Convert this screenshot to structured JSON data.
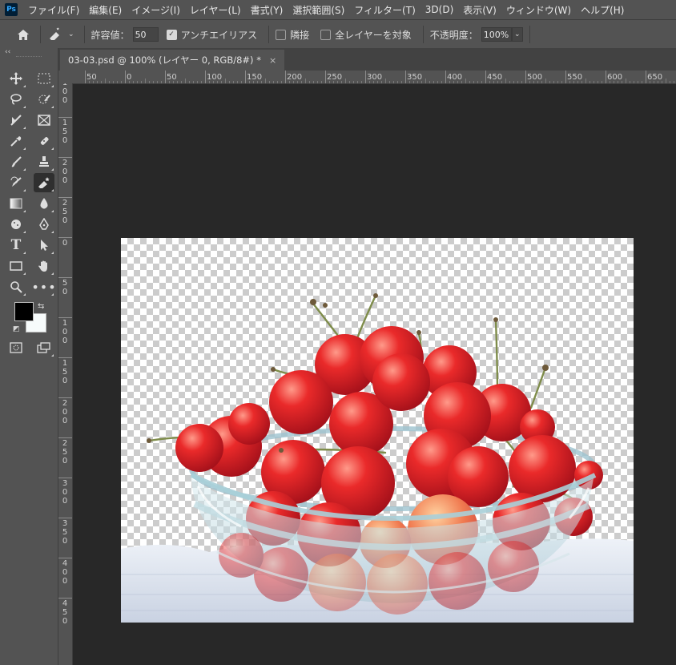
{
  "menu": {
    "logo": "Ps",
    "items": [
      "ファイル(F)",
      "編集(E)",
      "イメージ(I)",
      "レイヤー(L)",
      "書式(Y)",
      "選択範囲(S)",
      "フィルター(T)",
      "3D(D)",
      "表示(V)",
      "ウィンドウ(W)",
      "ヘルプ(H)"
    ]
  },
  "options": {
    "tolerance_label": "許容値：",
    "tolerance_value": "50",
    "antialias_label": "アンチエイリアス",
    "contiguous_label": "隣接",
    "all_layers_label": "全レイヤーを対象",
    "opacity_label": "不透明度：",
    "opacity_value": "100%"
  },
  "document": {
    "tab_title": "03-03.psd @ 100% (レイヤー 0, RGB/8#) *",
    "close_glyph": "×"
  },
  "rulers": {
    "top_labels": [
      "50",
      "0",
      "50",
      "100",
      "150",
      "200",
      "250",
      "300",
      "350",
      "400",
      "450",
      "500",
      "550",
      "600",
      "650"
    ],
    "left_labels": [
      "5\n0",
      "1\n0\n0",
      "1\n5\n0",
      "2\n0\n0",
      "2\n5\n0",
      "0",
      "5\n0",
      "1\n0\n0",
      "1\n5\n0",
      "2\n0\n0",
      "2\n5\n0",
      "3\n0\n0",
      "3\n5\n0",
      "4\n0\n0",
      "4\n5\n0"
    ]
  },
  "colors": {
    "foreground": "#000000",
    "background": "#f7fbfb",
    "ui_panel": "#535353",
    "workspace": "#282828"
  },
  "tools": {
    "collapse_glyph": "‹‹",
    "swap_glyph": "⇆",
    "default_glyph": "◩"
  }
}
